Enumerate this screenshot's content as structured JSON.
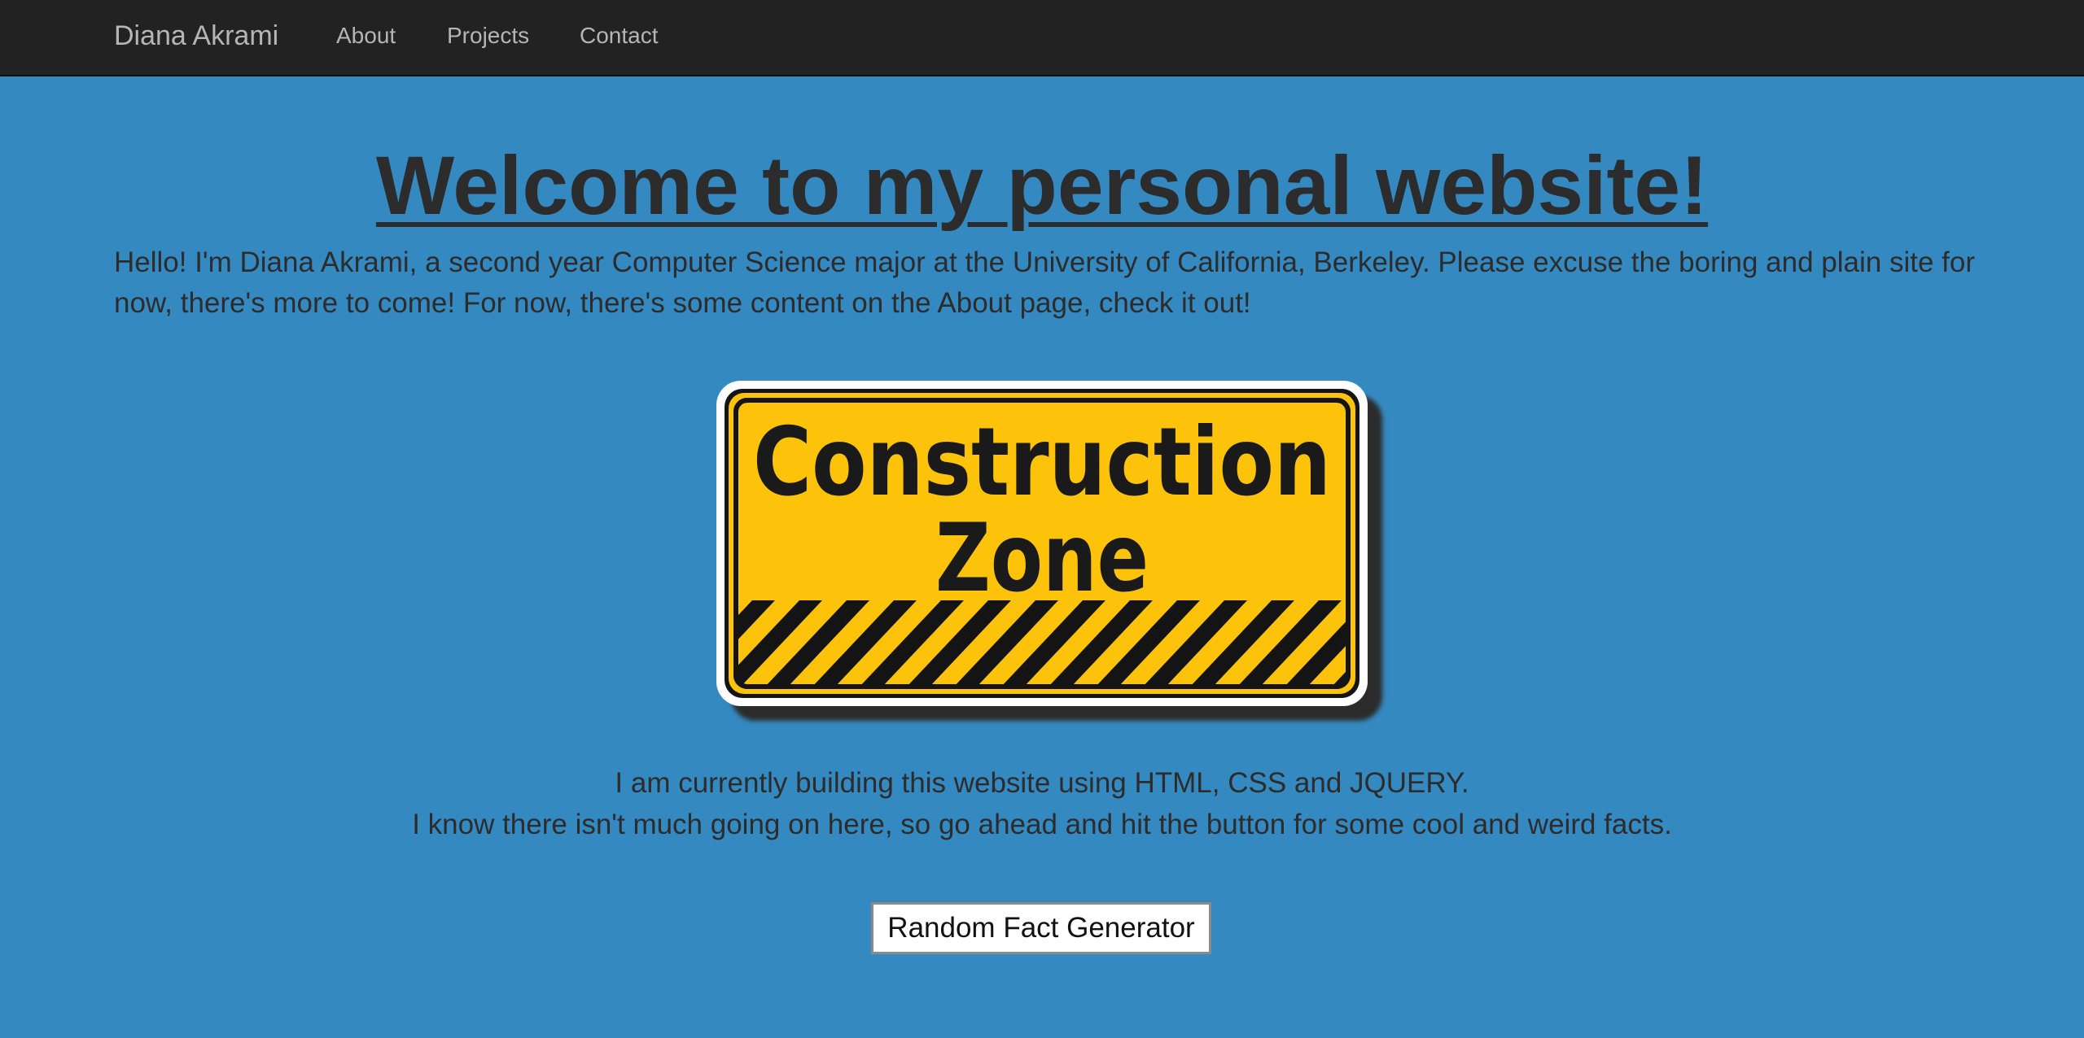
{
  "navbar": {
    "brand": "Diana Akrami",
    "links": [
      "About",
      "Projects",
      "Contact"
    ]
  },
  "main": {
    "heading": "Welcome to my personal website!",
    "intro": "Hello! I'm Diana Akrami, a second year Computer Science major at the University of California, Berkeley. Please excuse the boring and plain site for now, there's more to come! For now, there's some content on the About page, check it out!",
    "sign_image": {
      "line1": "Construction",
      "line2": "Zone"
    },
    "sub_line_1": "I am currently building this website using HTML, CSS and JQUERY.",
    "sub_line_2": "I know there isn't much going on here, so go ahead and hit the button for some cool and weird facts.",
    "button_label": "Random Fact Generator"
  },
  "colors": {
    "page_background": "#3589c1",
    "navbar_background": "#222222",
    "text": "#2c2c2c",
    "sign_yellow": "#fdc20a"
  }
}
